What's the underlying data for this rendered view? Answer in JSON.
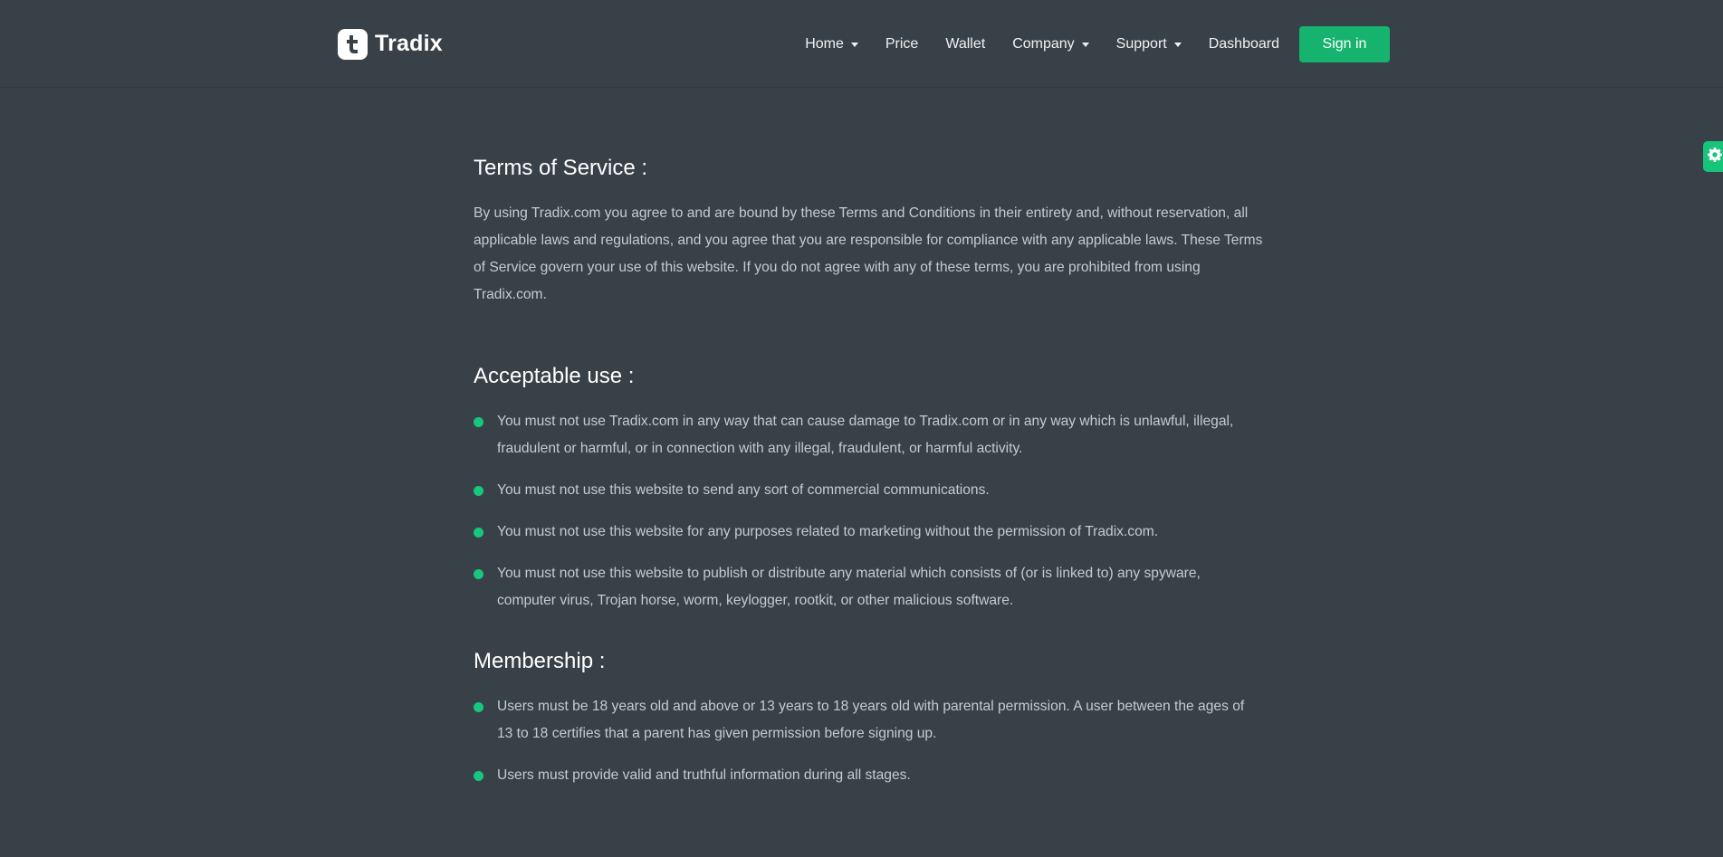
{
  "brand": {
    "name": "Tradix",
    "logo_letter": "t"
  },
  "nav": {
    "items": [
      {
        "label": "Home",
        "dropdown": true
      },
      {
        "label": "Price",
        "dropdown": false
      },
      {
        "label": "Wallet",
        "dropdown": false
      },
      {
        "label": "Company",
        "dropdown": true
      },
      {
        "label": "Support",
        "dropdown": true
      },
      {
        "label": "Dashboard",
        "dropdown": false
      }
    ],
    "signin_label": "Sign in"
  },
  "colors": {
    "background": "#394148",
    "accent": "#16b36e",
    "text": "#c4cbd1"
  },
  "sections": {
    "terms": {
      "title": "Terms of Service :",
      "body": "By using Tradix.com you agree to and are bound by these Terms and Conditions in their entirety and, without reservation, all applicable laws and regulations, and you agree that you are responsible for compliance with any applicable laws. These Terms of Service govern your use of this website. If you do not agree with any of these terms, you are prohibited from using Tradix.com."
    },
    "acceptable_use": {
      "title": "Acceptable use :",
      "items": [
        "You must not use Tradix.com in any way that can cause damage to Tradix.com or in any way which is unlawful, illegal, fraudulent or harmful, or in connection with any illegal, fraudulent, or harmful activity.",
        "You must not use this website to send any sort of commercial communications.",
        "You must not use this website for any purposes related to marketing without the permission of Tradix.com.",
        "You must not use this website to publish or distribute any material which consists of (or is linked to) any spyware, computer virus, Trojan horse, worm, keylogger, rootkit, or other malicious software."
      ]
    },
    "membership": {
      "title": "Membership :",
      "items": [
        "Users must be 18 years old and above or 13 years to 18 years old with parental permission. A user between the ages of 13 to 18 certifies that a parent has given permission before signing up.",
        "Users must provide valid and truthful information during all stages."
      ]
    }
  },
  "icons": {
    "settings": "gear-icon",
    "logo": "tradix-logo-icon",
    "caret": "caret-down-icon"
  }
}
